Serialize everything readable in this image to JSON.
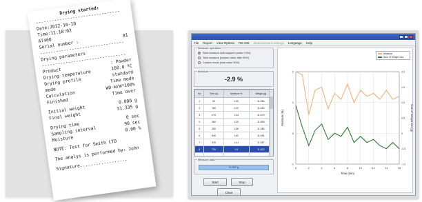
{
  "receipt": {
    "title": "Drying started:",
    "dash": "--------------------------------",
    "date_label": "Date",
    "date_value": ":2012-10-10",
    "time_label": "Time",
    "time_value": ":11:18:02",
    "id_label": "AT460",
    "serial_label": "Serial number :",
    "serial_value": "81",
    "params_title": "Drying parameters",
    "rows": [
      {
        "k": "Product",
        "v": ": Powder"
      },
      {
        "k": "Drying temperature",
        "v": "160.0 ºC"
      },
      {
        "k": "Drying profile",
        "v": "standard"
      },
      {
        "k": "mode",
        "v": "Time mode"
      },
      {
        "k": "Calculation",
        "v": "WD-W/W*100%"
      },
      {
        "k": "Finished",
        "v": "Time over"
      },
      {
        "k": "Initial weight",
        "v": "0.000 g"
      },
      {
        "k": "Final weight",
        "v": "31.335 g"
      },
      {
        "k": "Drying time",
        "v": "0 sec"
      },
      {
        "k": "Sampling interval",
        "v": "90 sec"
      },
      {
        "k": "Moisture",
        "v": "0.00 %"
      }
    ],
    "note": "NOTE: Test for Smith LTD",
    "performed": "The analys is performed by: John",
    "signature": "Signature.................."
  },
  "app": {
    "menu": [
      "File",
      "Report",
      "View Options",
      "RS-232",
      "Measurement settings",
      "Language",
      "Help"
    ],
    "measure_group_title": "Measure operation",
    "radio_options": [
      {
        "label": "Start measure until stopped (under 0.5%)",
        "on": true
      },
      {
        "label": "Start measure (custom value after 50%)",
        "on": false
      },
      {
        "label": "Custom mode (load value 50%)",
        "on": false
      }
    ],
    "moisture_group_title": "Moisture",
    "moisture_value": "-2.9 %",
    "table": {
      "headers": [
        "No",
        "Time (s)",
        "Moisture %",
        "Weight (g)"
      ],
      "rows": [
        [
          "1",
          "90",
          "1.30",
          "11.554"
        ],
        [
          "2",
          "180",
          "1.20",
          "11.542"
        ],
        [
          "3",
          "270",
          "1.44",
          "11.570"
        ],
        [
          "4",
          "360",
          "1.30",
          "11.555"
        ],
        [
          "5",
          "450",
          "1.56",
          "11.584"
        ],
        [
          "6",
          "540",
          "1.62",
          "11.591"
        ],
        [
          "7",
          "630",
          "1.41",
          "11.567"
        ],
        [
          "8",
          "720",
          "1.9",
          "11.622"
        ],
        [
          "",
          "",
          "",
          ""
        ],
        [
          "",
          "",
          "",
          ""
        ]
      ],
      "selected_row": 7
    },
    "status_group_title": "Measure data",
    "status_value": "11.537 g",
    "buttons": {
      "start": "Start",
      "stop": "Stop",
      "clear": "Clear"
    },
    "colors": {
      "titlebar": "#2d55b0",
      "moisture_line": "#f0b27a",
      "weight_line": "#2e7d32",
      "status_fill": "#9cc0ec"
    }
  },
  "chart_data": {
    "type": "line",
    "x": [
      0,
      1,
      2,
      3,
      4,
      5,
      6,
      7,
      8,
      9,
      10,
      11,
      12,
      13,
      14,
      15,
      16
    ],
    "series": [
      {
        "name": "Moisture",
        "values": [
          2.0,
          1.9,
          0.6,
          1.4,
          1.5,
          0.8,
          1.3,
          1.1,
          1.6,
          1.0,
          1.4,
          1.2,
          1.3,
          1.1,
          1.4,
          1.1,
          1.2
        ]
      },
      {
        "name": "Sum of Weight loss",
        "values": [
          0.9,
          0.2,
          -0.4,
          0.1,
          0.3,
          -0.2,
          0.0,
          -0.1,
          0.2,
          -0.3,
          -0.1,
          -0.3,
          -0.2,
          -0.4,
          -0.5,
          -0.3,
          -0.5
        ]
      }
    ],
    "xlabel": "Time (min)",
    "ylabel": "Moisture (%)",
    "y2label": "Sum of Weight loss (g)",
    "xticks": [
      "0",
      "2",
      "4",
      "6",
      "8",
      "10",
      "12",
      "14",
      "16"
    ],
    "ylim": [
      -1,
      2
    ],
    "yticks": [
      "2",
      "1",
      "0",
      "-1"
    ],
    "y2ticks": [
      "2.0",
      "1.5",
      "1.0",
      "0.5",
      "0",
      "-0.5",
      "-1.0"
    ],
    "legend": "top-right",
    "grid": true
  }
}
